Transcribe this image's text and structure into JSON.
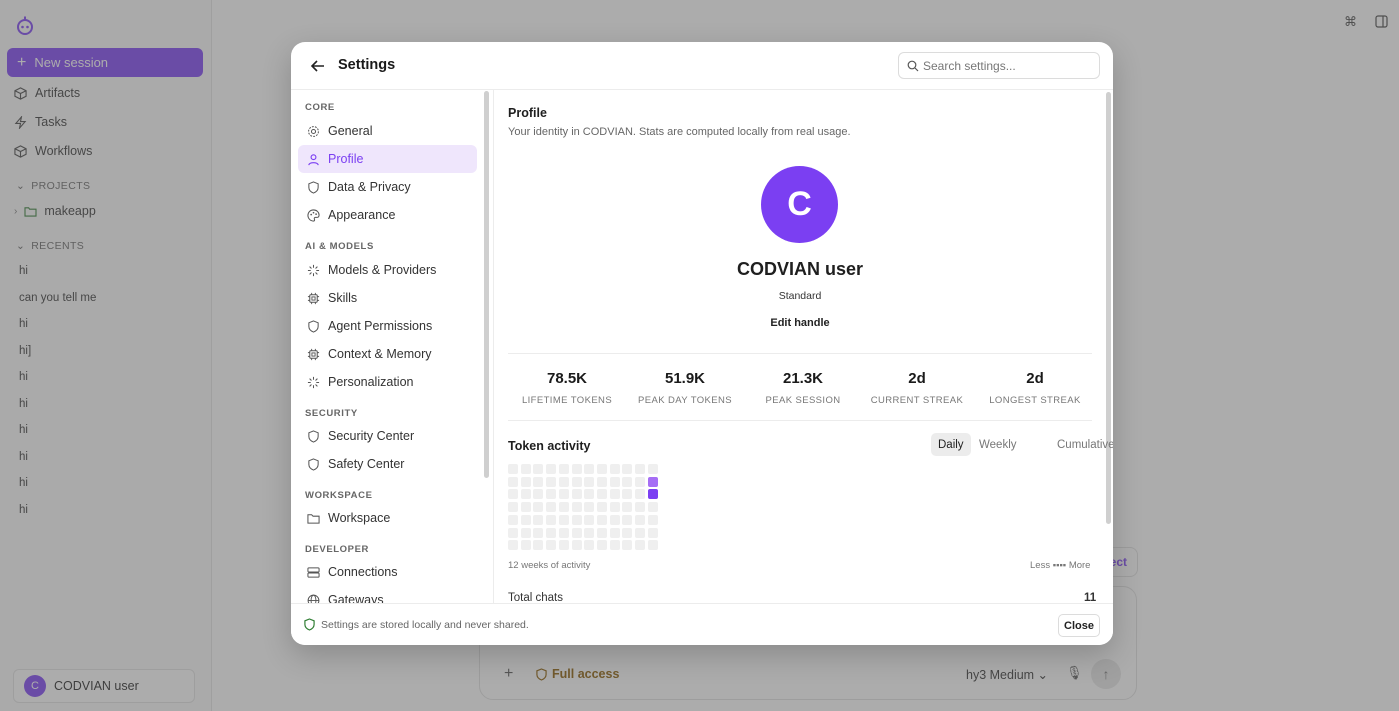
{
  "sidebar": {
    "new_session": "New session",
    "nav": [
      {
        "label": "Artifacts",
        "icon": "cube-icon"
      },
      {
        "label": "Tasks",
        "icon": "bolt-icon"
      },
      {
        "label": "Workflows",
        "icon": "cube-icon"
      }
    ],
    "projects_label": "PROJECTS",
    "project": "makeapp",
    "recents_label": "RECENTS",
    "recents": [
      "hi",
      "can you tell me",
      "hi",
      "hi]",
      "hi",
      "hi",
      "hi",
      "hi",
      "hi",
      "hi"
    ],
    "user": {
      "initial": "C",
      "name": "CODVIAN user"
    }
  },
  "composer": {
    "plus": "+",
    "access": "Full access",
    "model": "hy3 Medium ⌄",
    "connect": "ect"
  },
  "settings": {
    "title": "Settings",
    "search_placeholder": "Search settings...",
    "groups": [
      {
        "label": "CORE",
        "items": [
          {
            "label": "General",
            "icon": "gear-icon"
          },
          {
            "label": "Profile",
            "icon": "user-icon",
            "active": true
          },
          {
            "label": "Data & Privacy",
            "icon": "shield-icon"
          },
          {
            "label": "Appearance",
            "icon": "palette-icon"
          }
        ]
      },
      {
        "label": "AI & MODELS",
        "items": [
          {
            "label": "Models & Providers",
            "icon": "sparkle-icon"
          },
          {
            "label": "Skills",
            "icon": "chip-icon"
          },
          {
            "label": "Agent Permissions",
            "icon": "shield-icon"
          },
          {
            "label": "Context & Memory",
            "icon": "chip-icon"
          },
          {
            "label": "Personalization",
            "icon": "sparkle-icon"
          }
        ]
      },
      {
        "label": "SECURITY",
        "items": [
          {
            "label": "Security Center",
            "icon": "shield-icon"
          },
          {
            "label": "Safety Center",
            "icon": "shield-icon"
          }
        ]
      },
      {
        "label": "WORKSPACE",
        "items": [
          {
            "label": "Workspace",
            "icon": "folder-icon"
          }
        ]
      },
      {
        "label": "DEVELOPER",
        "items": [
          {
            "label": "Connections",
            "icon": "server-icon"
          },
          {
            "label": "Gateways",
            "icon": "globe-icon"
          }
        ]
      }
    ],
    "footer_note": "Settings are stored locally and never shared.",
    "close_label": "Close"
  },
  "profile": {
    "title": "Profile",
    "description": "Your identity in CODVIAN. Stats are computed locally from real usage.",
    "avatar_initial": "C",
    "name": "CODVIAN user",
    "tier": "Standard",
    "edit_handle": "Edit handle",
    "stats": [
      {
        "value": "78.5K",
        "label": "LIFETIME TOKENS"
      },
      {
        "value": "51.9K",
        "label": "PEAK DAY TOKENS"
      },
      {
        "value": "21.3K",
        "label": "PEAK SESSION"
      },
      {
        "value": "2d",
        "label": "CURRENT STREAK"
      },
      {
        "value": "2d",
        "label": "LONGEST STREAK"
      }
    ],
    "token_activity": {
      "title": "Token activity",
      "toggles": [
        "Daily",
        "Weekly",
        "Cumulative"
      ],
      "active_toggle": "Daily",
      "weeks": 12,
      "days": 7,
      "active_cells": [
        {
          "week": 11,
          "day": 1,
          "level": 2
        },
        {
          "week": 11,
          "day": 2,
          "level": 3
        }
      ],
      "caption": "12 weeks of activity",
      "legend": "Less ▪▪▪▪ More"
    },
    "total_chats_label": "Total chats",
    "total_chats_value": "11"
  },
  "colors": {
    "accent": "#7b3ff2",
    "accent_light": "#efe6fc",
    "cell_empty": "#efefef"
  }
}
